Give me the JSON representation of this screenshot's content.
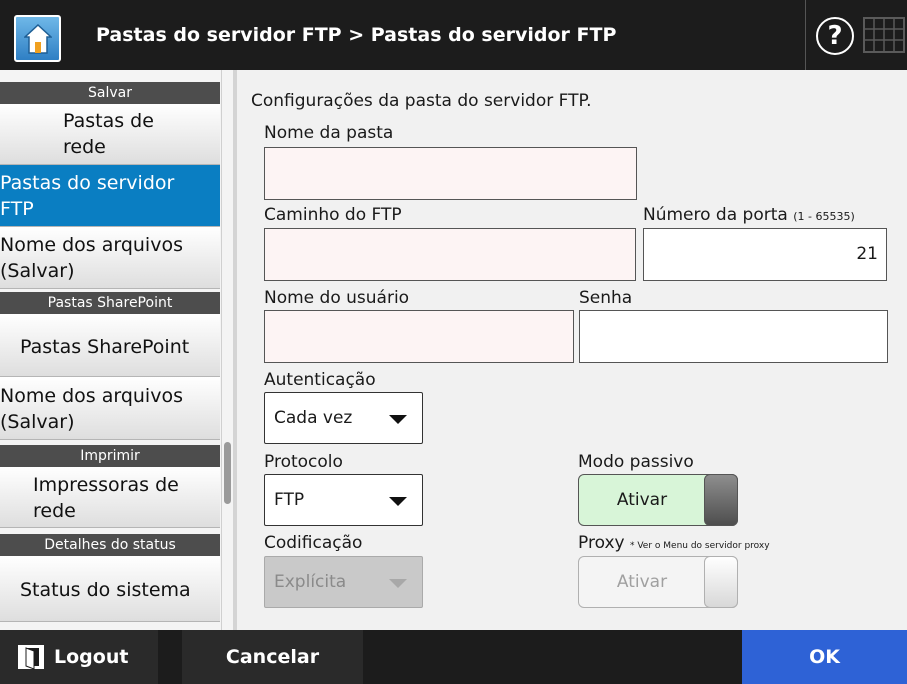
{
  "header": {
    "title": "Pastas do servidor FTP > Pastas do servidor FTP",
    "help_symbol": "?",
    "home_icon": "home-icon",
    "keyboard_icon": "keyboard-icon"
  },
  "sidebar": {
    "sections": {
      "salvar": "Salvar",
      "sharepoint": "Pastas SharePoint",
      "imprimir": "Imprimir",
      "detalhes": "Detalhes do status"
    },
    "items": {
      "pastas_rede": [
        "Pastas de",
        "rede"
      ],
      "pastas_ftp": [
        "Pastas do servidor",
        "FTP"
      ],
      "nome_arquivos_1": [
        "Nome dos arquivos",
        "(Salvar)"
      ],
      "pastas_sharepoint": "Pastas SharePoint",
      "nome_arquivos_2": [
        "Nome dos arquivos",
        "(Salvar)"
      ],
      "impressoras": [
        "Impressoras de",
        "rede"
      ],
      "status_sistema": "Status do sistema"
    }
  },
  "main": {
    "heading": "Configurações da pasta do servidor FTP.",
    "folder_name_label": "Nome da pasta",
    "folder_name_value": "",
    "ftp_path_label": "Caminho do FTP",
    "ftp_path_value": "",
    "port_label": "Número da porta",
    "port_range": "(1 - 65535)",
    "port_value": "21",
    "username_label": "Nome do usuário",
    "username_value": "",
    "password_label": "Senha",
    "password_value": "",
    "auth_label": "Autenticação",
    "auth_value": "Cada vez",
    "protocol_label": "Protocolo",
    "protocol_value": "FTP",
    "passive_label": "Modo passivo",
    "passive_value": "Ativar",
    "encoding_label": "Codificação",
    "encoding_value": "Explícita",
    "proxy_label": "Proxy",
    "proxy_note": "* Ver o Menu do servidor proxy",
    "proxy_value": "Ativar"
  },
  "footer": {
    "logout": "Logout",
    "cancel": "Cancelar",
    "ok": "OK"
  },
  "colors": {
    "header_bg": "#1c1c1c",
    "selected_item": "#0a7ec2",
    "ok_button": "#2e62d6",
    "toggle_on": "#d8f5d8"
  }
}
